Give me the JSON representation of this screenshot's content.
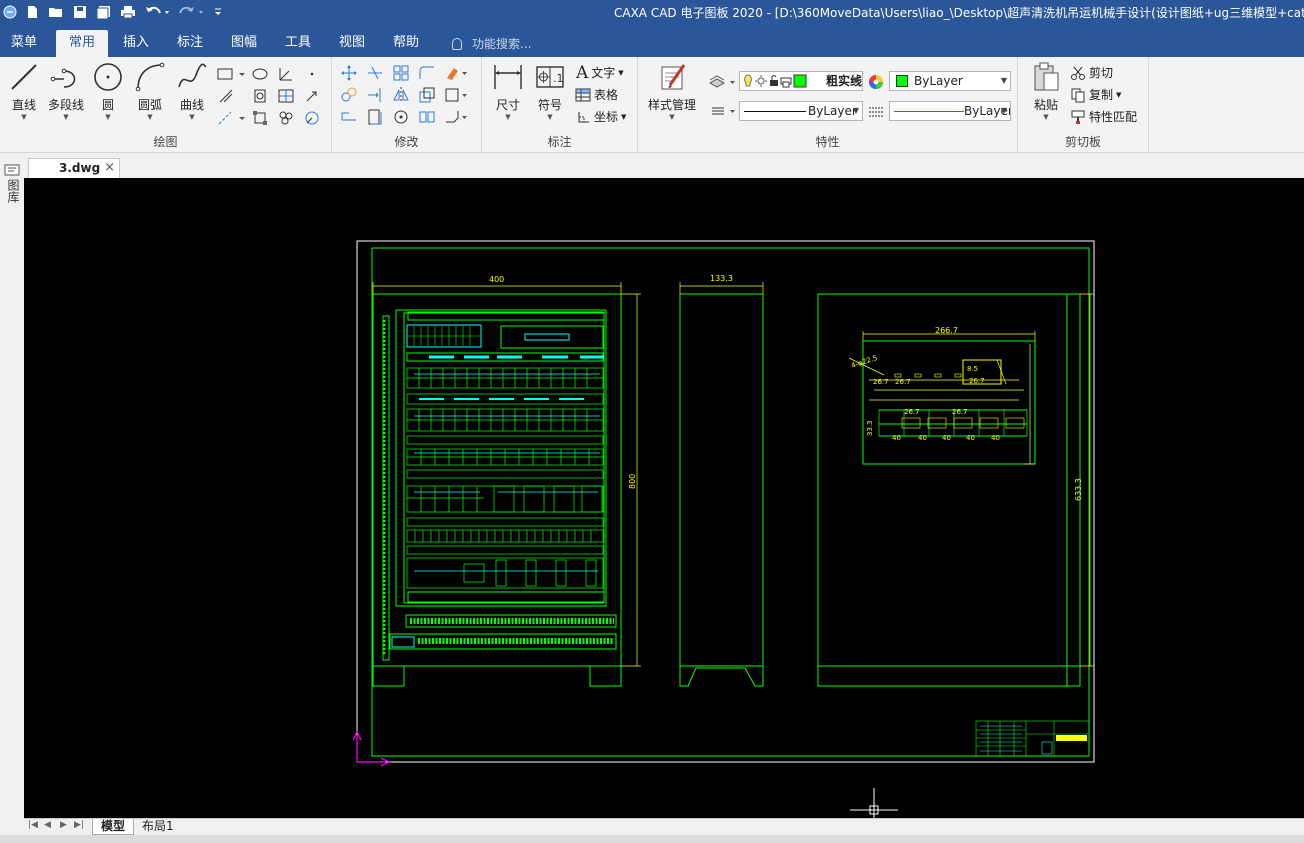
{
  "window": {
    "title": "CAXA CAD 电子图板 2020 - [D:\\360MoveData\\Users\\liao_\\Desktop\\超声清洗机吊运机械手设计(设计图纸+ug三维模型+catia三"
  },
  "menu": {
    "tabs": [
      "菜单",
      "常用",
      "插入",
      "标注",
      "图幅",
      "工具",
      "视图",
      "帮助"
    ],
    "active_tab": "常用",
    "search_placeholder": "功能搜索..."
  },
  "ribbon": {
    "draw": {
      "label": "绘图",
      "line": "直线",
      "polyline": "多段线",
      "circle": "圆",
      "arc": "圆弧",
      "curve": "曲线"
    },
    "modify": {
      "label": "修改"
    },
    "annotate": {
      "label": "标注",
      "dimension": "尺寸",
      "symbol": "符号",
      "text": "文字",
      "table": "表格",
      "coordinate": "坐标"
    },
    "properties": {
      "label": "特性",
      "style_manager": "样式管理",
      "layer_name": "粗实线",
      "color_value": "ByLayer",
      "linetype_value": "ByLayer",
      "lineweight_value": "ByLayer"
    },
    "clipboard": {
      "label": "剪切板",
      "paste": "粘贴",
      "cut": "剪切",
      "copy": "复制",
      "match_props": "特性匹配"
    }
  },
  "documents": {
    "active_tab": "3.dwg",
    "side_panel_label": "图库"
  },
  "layouts": {
    "tabs": [
      "模型",
      "布局1"
    ],
    "active": "模型"
  },
  "drawing": {
    "dims": {
      "front_width": "400",
      "front_height": "800",
      "side_width": "133.3",
      "rear_height": "633.3",
      "plate_width": "266.7",
      "hole_note": "4-φ22.5",
      "spacing_a": "26.7",
      "spacing_b": "8.5",
      "spacing_c": "40",
      "small_dim": "33.3"
    }
  },
  "colors": {
    "ribbon_blue": "#2b579a",
    "canvas_bg": "#000000",
    "frame": "#ffffff",
    "outline": "#00ff00",
    "dimension": "#ffff00",
    "component": "#00ffff",
    "ucs": "#ff00ff"
  }
}
